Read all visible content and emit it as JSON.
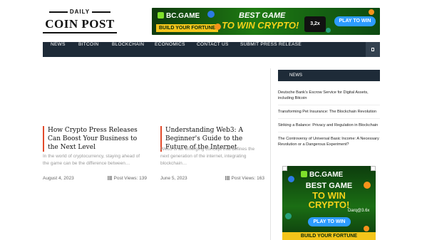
{
  "logo": {
    "top": "DAILY",
    "name": "COIN POST"
  },
  "top_banner": {
    "brand": "BC.GAME",
    "tagline": "BUILD YOUR FORTUNE",
    "line1": "BEST GAME",
    "line2": "TO WIN CRYPTO!",
    "multiplier": "3,2x",
    "cta": "PLAY TO WIN"
  },
  "nav": {
    "items": [
      "NEWS",
      "BITCOIN",
      "BLOCKCHAIN",
      "ECONOMICS",
      "CONTACT US",
      "SUBMIT PRESS RELEASE"
    ],
    "search_icon": "search-icon"
  },
  "posts": [
    {
      "title": "How Crypto Press Releases Can Boost Your Business to the Next Level",
      "excerpt": "In the world of cryptocurrency, staying ahead of the game can be the difference between…",
      "date": "August 4, 2023",
      "views": "Post Views: 139"
    },
    {
      "title": "Understanding Web3: A Beginner's Guide to the Future of the Internet",
      "excerpt": "Web3 is an emerging concept that defines the next generation of the internet, integrating blockchain…",
      "date": "June 5, 2023",
      "views": "Post Views: 163"
    }
  ],
  "sidebar": {
    "heading": "NEWS",
    "items": [
      "Deutsche Bank's Escrow Service for Digital Assets, including Bitcoin",
      "Transforming Pet Insurance: The Blockchain Revolution",
      "Striking a Balance: Privacy and Regulation in Blockchain",
      "The Controversy of Universal Basic Income: A Necessary Revolution or a Dangerous Experiment?"
    ]
  },
  "side_banner": {
    "brand": "BC.GAME",
    "line1": "BEST GAME",
    "line2": "TO WIN",
    "line3": "CRYPTO!",
    "multiplier": "Darq@3.6x",
    "cta": "PLAY TO WIN",
    "footer": "BUILD YOUR FORTUNE"
  },
  "colors": {
    "nav_bg": "#1e2b38",
    "accent": "#e24a2b",
    "banner_green": "#1e7a12",
    "banner_yellow": "#f6d21a"
  }
}
